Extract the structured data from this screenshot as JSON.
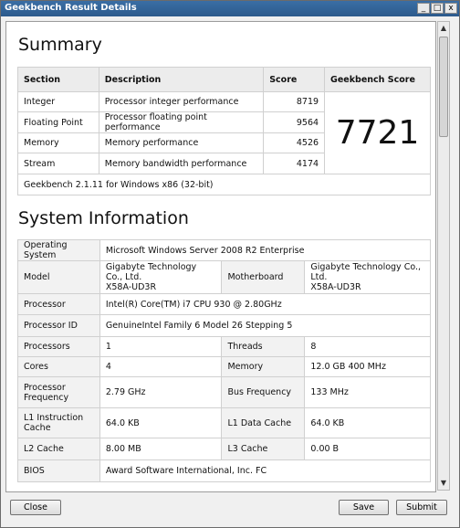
{
  "window": {
    "title": "Geekbench Result Details",
    "min": "_",
    "max": "□",
    "close": "x"
  },
  "summary": {
    "heading": "Summary",
    "headers": {
      "section": "Section",
      "description": "Description",
      "score": "Score",
      "geekbench": "Geekbench Score"
    },
    "rows": [
      {
        "section": "Integer",
        "description": "Processor integer performance",
        "score": "8719"
      },
      {
        "section": "Floating Point",
        "description": "Processor floating point performance",
        "score": "9564"
      },
      {
        "section": "Memory",
        "description": "Memory performance",
        "score": "4526"
      },
      {
        "section": "Stream",
        "description": "Memory bandwidth performance",
        "score": "4174"
      }
    ],
    "geekbench_score": "7721",
    "version": "Geekbench 2.1.11 for Windows x86 (32-bit)"
  },
  "sysinfo": {
    "heading": "System Information",
    "os_label": "Operating System",
    "os_value": "Microsoft Windows Server 2008 R2 Enterprise",
    "model_label": "Model",
    "model_value_1": "Gigabyte Technology Co., Ltd.",
    "model_value_2": "X58A-UD3R",
    "motherboard_label": "Motherboard",
    "motherboard_value_1": "Gigabyte Technology Co., Ltd.",
    "motherboard_value_2": "X58A-UD3R",
    "processor_label": "Processor",
    "processor_value": "Intel(R) Core(TM) i7 CPU 930 @ 2.80GHz",
    "processor_id_label": "Processor ID",
    "processor_id_value": "GenuineIntel Family 6 Model 26 Stepping 5",
    "processors_label": "Processors",
    "processors_value": "1",
    "threads_label": "Threads",
    "threads_value": "8",
    "cores_label": "Cores",
    "cores_value": "4",
    "memory_label": "Memory",
    "memory_value": "12.0 GB  400 MHz",
    "freq_label_1": "Processor",
    "freq_label_2": "Frequency",
    "freq_value": "2.79 GHz",
    "bus_label": "Bus Frequency",
    "bus_value": "133 MHz",
    "l1i_label_1": "L1 Instruction",
    "l1i_label_2": "Cache",
    "l1i_value": "64.0 KB",
    "l1d_label": "L1 Data Cache",
    "l1d_value": "64.0 KB",
    "l2_label": "L2 Cache",
    "l2_value": "8.00 MB",
    "l3_label": "L3 Cache",
    "l3_value": "0.00 B",
    "bios_label": "BIOS",
    "bios_value": "Award Software International, Inc. FC"
  },
  "footer": {
    "close": "Close",
    "save": "Save",
    "submit": "Submit"
  }
}
